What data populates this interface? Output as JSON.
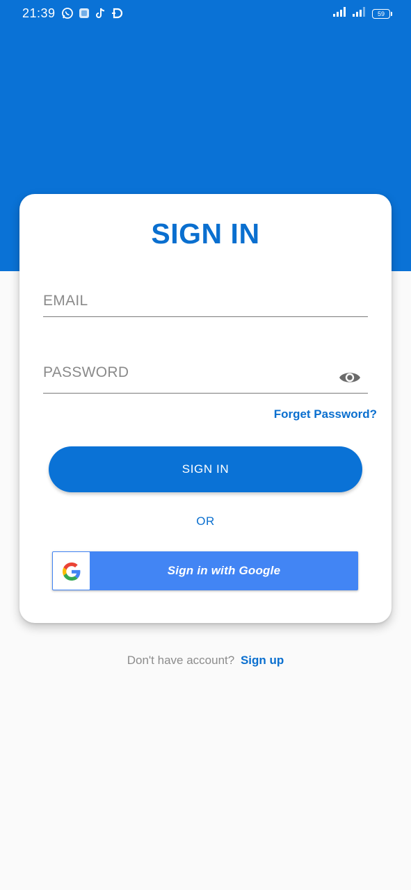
{
  "status_bar": {
    "time": "21:39",
    "battery": "59",
    "app_icons": [
      "whatsapp-icon",
      "app-square-icon",
      "tiktok-icon",
      "d-app-icon"
    ]
  },
  "colors": {
    "primary": "#0a72d6",
    "google_blue": "#4285f4",
    "background": "#fafafa"
  },
  "card": {
    "title": "SIGN IN",
    "email_placeholder": "EMAIL",
    "password_placeholder": "PASSWORD",
    "forgot_label": "Forget Password?",
    "signin_label": "SIGN IN",
    "or_label": "OR",
    "google_label": "Sign in with Google"
  },
  "footer": {
    "prompt": "Don't have account?",
    "signup_label": "Sign up"
  }
}
